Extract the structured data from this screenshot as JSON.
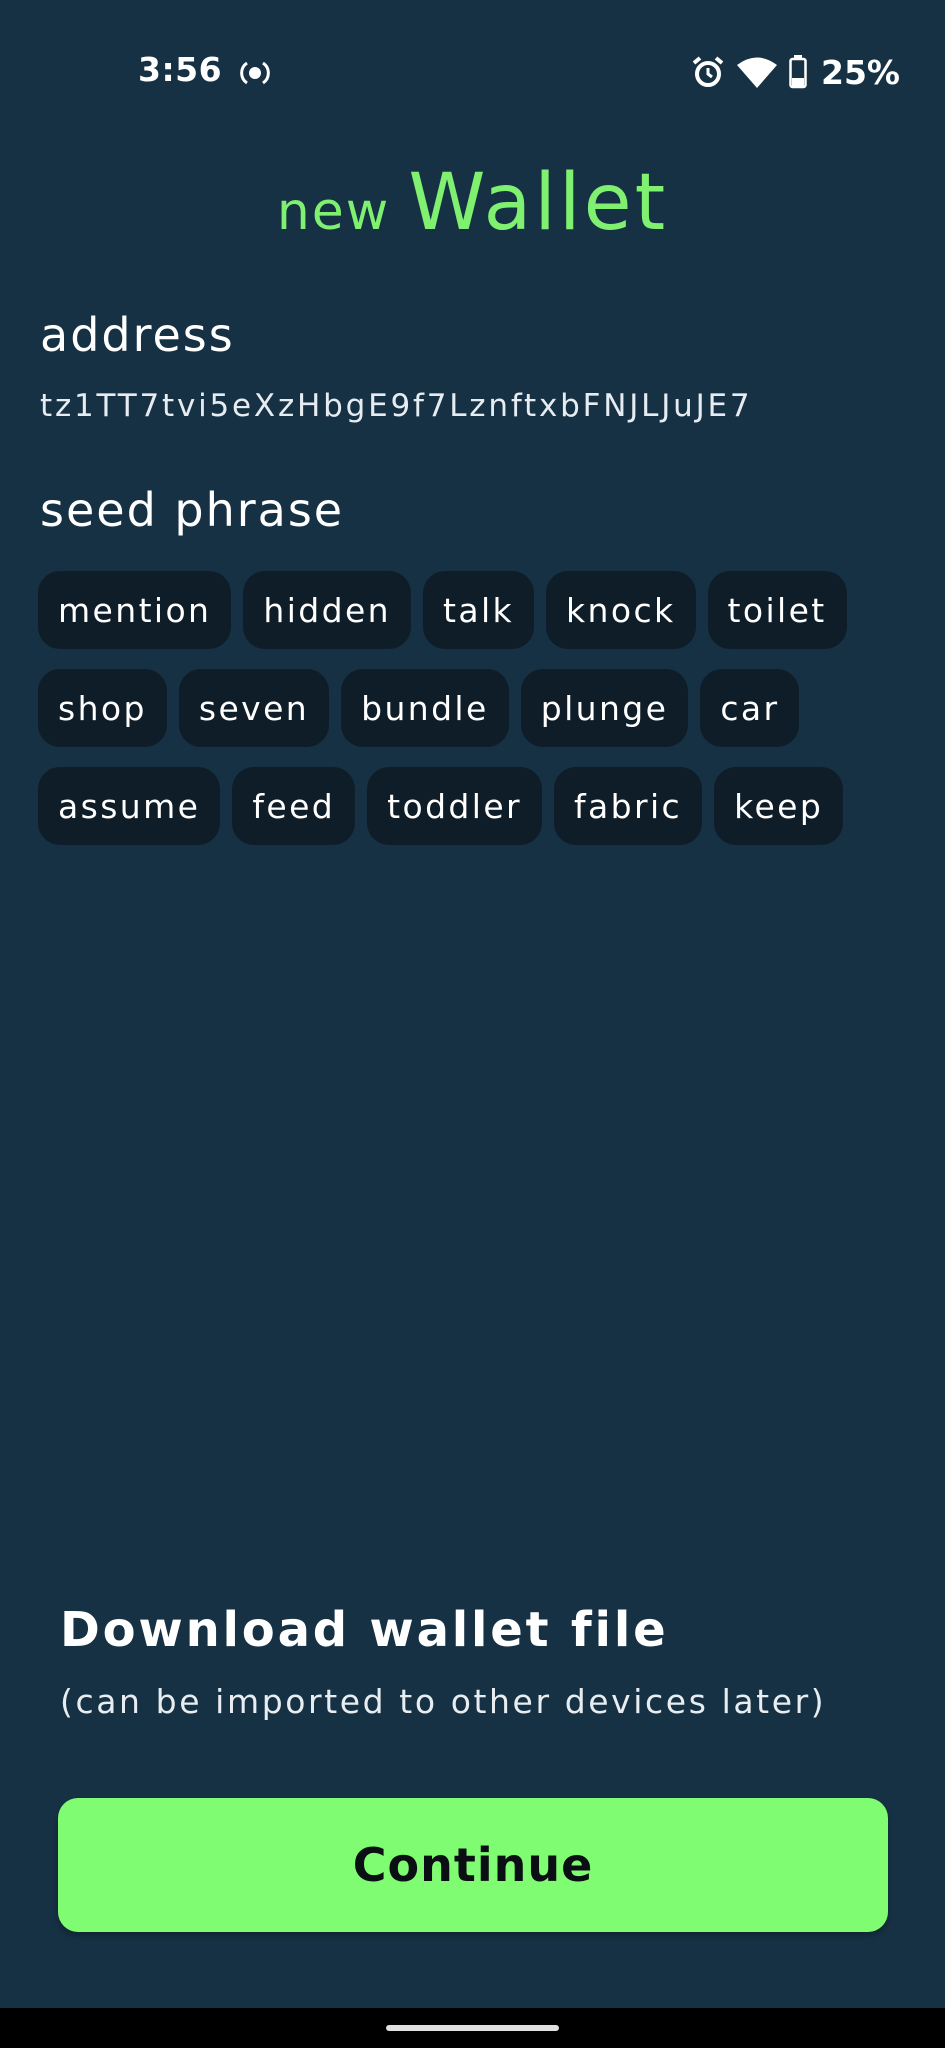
{
  "status_bar": {
    "time": "3:56",
    "battery": "25%",
    "icons": [
      "record-icon",
      "alarm-icon",
      "wifi-icon",
      "battery-icon"
    ]
  },
  "title": {
    "prefix": "new",
    "main": "Wallet"
  },
  "address": {
    "label": "address",
    "value": "tz1TT7tvi5eXzHbgE9f7LznftxbFNJLJuJE7"
  },
  "seed": {
    "label": "seed phrase",
    "rows": [
      [
        "mention",
        "hidden",
        "talk",
        "knock",
        "toilet"
      ],
      [
        "shop",
        "seven",
        "bundle",
        "plunge",
        "car"
      ],
      [
        "assume",
        "feed",
        "toddler",
        "fabric",
        "keep"
      ]
    ]
  },
  "download": {
    "title": "Download wallet file",
    "subtitle": "(can be imported to other devices later)"
  },
  "continue_label": "Continue",
  "colors": {
    "background": "#163144",
    "accent": "#7ff06f",
    "button": "#80fc72",
    "chip": "#0f1d29"
  }
}
